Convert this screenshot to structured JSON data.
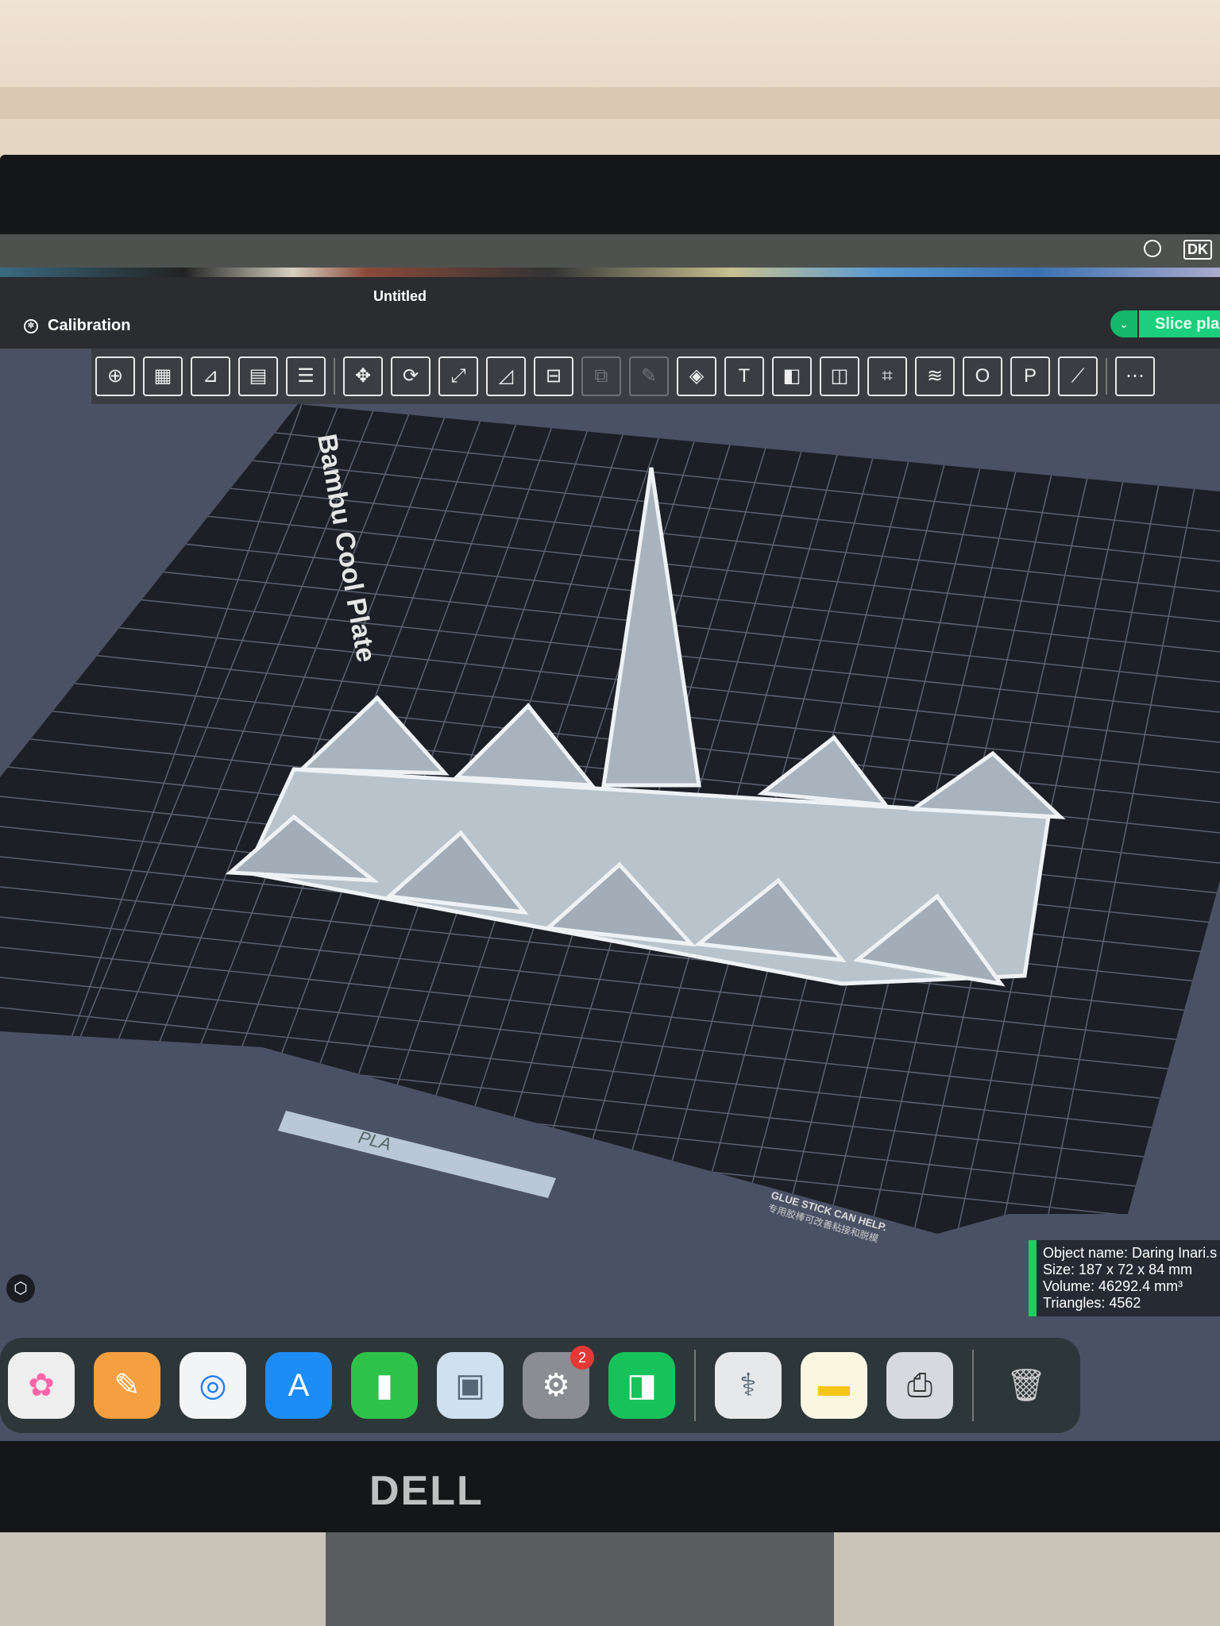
{
  "menubar": {
    "user_initials": "DK"
  },
  "app": {
    "title": "Untitled",
    "calibration_label": "Calibration",
    "slice_label": "Slice pla"
  },
  "toolbar": {
    "icons": [
      "add-object",
      "add-plate",
      "auto-orient",
      "arrange",
      "split-plates",
      "move",
      "rotate",
      "scale",
      "lay-on-face",
      "cut",
      "boolean",
      "support-paint",
      "color-paint",
      "text",
      "emboss",
      "mesh-boolean",
      "measure-fix",
      "layer-height",
      "assembly",
      "plate-o",
      "plate-p",
      "ruler",
      "more"
    ]
  },
  "plate": {
    "name": "Bambu Cool Plate",
    "material": "PLA",
    "notice": "GLUE STICK CAN HELP.",
    "notice_cn": "专用胶棒可改善粘接和脱模"
  },
  "object_info": {
    "name": "Object name: Daring Inari.s",
    "size": "Size: 187 x 72 x 84 mm",
    "volume": "Volume: 46292.4 mm³",
    "triangles": "Triangles: 4562"
  },
  "colors": {
    "accent": "#1ccf7c",
    "viewport": "#4b5165",
    "plate": "#1c1f26",
    "model": "#b8c2cc"
  },
  "dock": {
    "items": [
      "photos",
      "freeform",
      "safari",
      "app-store",
      "numbers",
      "preview",
      "system-settings",
      "bambu-studio",
      "disk-utility",
      "notes",
      "printer",
      "trash"
    ],
    "settings_badge": "2"
  },
  "monitor": {
    "brand": "DELL"
  }
}
